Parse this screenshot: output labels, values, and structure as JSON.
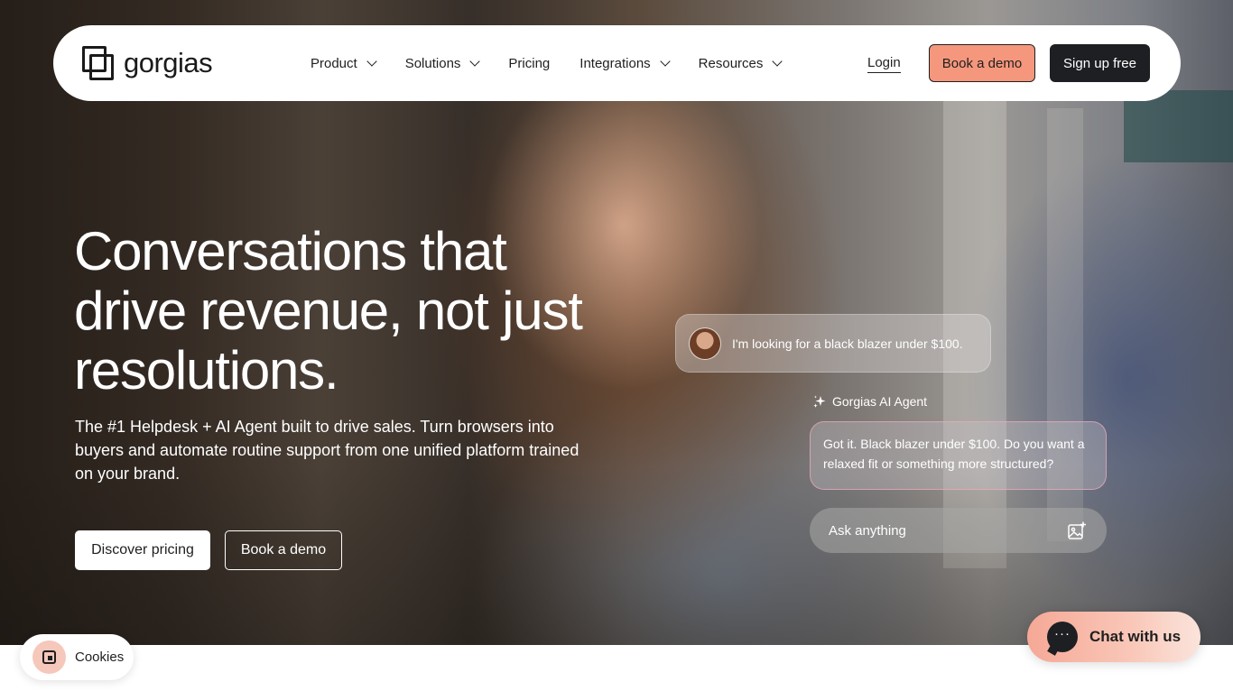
{
  "nav": {
    "logo_text": "gorgias",
    "items": [
      {
        "label": "Product",
        "has_dropdown": true
      },
      {
        "label": "Solutions",
        "has_dropdown": true
      },
      {
        "label": "Pricing",
        "has_dropdown": false
      },
      {
        "label": "Integrations",
        "has_dropdown": true
      },
      {
        "label": "Resources",
        "has_dropdown": true
      }
    ],
    "login_label": "Login",
    "book_demo_label": "Book a demo",
    "signup_label": "Sign up free"
  },
  "hero": {
    "headline": "Conversations that drive revenue, not just resolutions.",
    "subheadline": "The #1 Helpdesk + AI Agent built to drive sales. Turn browsers into buyers and automate routine support from one unified platform trained on your brand.",
    "discover_pricing_label": "Discover pricing",
    "book_demo_label": "Book a demo"
  },
  "chat_demo": {
    "user_message": "I'm looking for a black blazer under $100.",
    "agent_name": "Gorgias AI Agent",
    "agent_message": "Got it. Black blazer under $100. Do you want a relaxed fit or something more structured?",
    "input_placeholder": "Ask anything"
  },
  "cookies": {
    "label": "Cookies"
  },
  "chat_launcher": {
    "label": "Chat with us"
  },
  "colors": {
    "accent": "#f5977d",
    "dark": "#1d1f23",
    "white": "#ffffff"
  },
  "icons": [
    "gorgias-logo-icon",
    "chevron-down-icon",
    "sparkle-icon",
    "add-image-icon",
    "cookie-icon",
    "chat-bubble-icon"
  ]
}
